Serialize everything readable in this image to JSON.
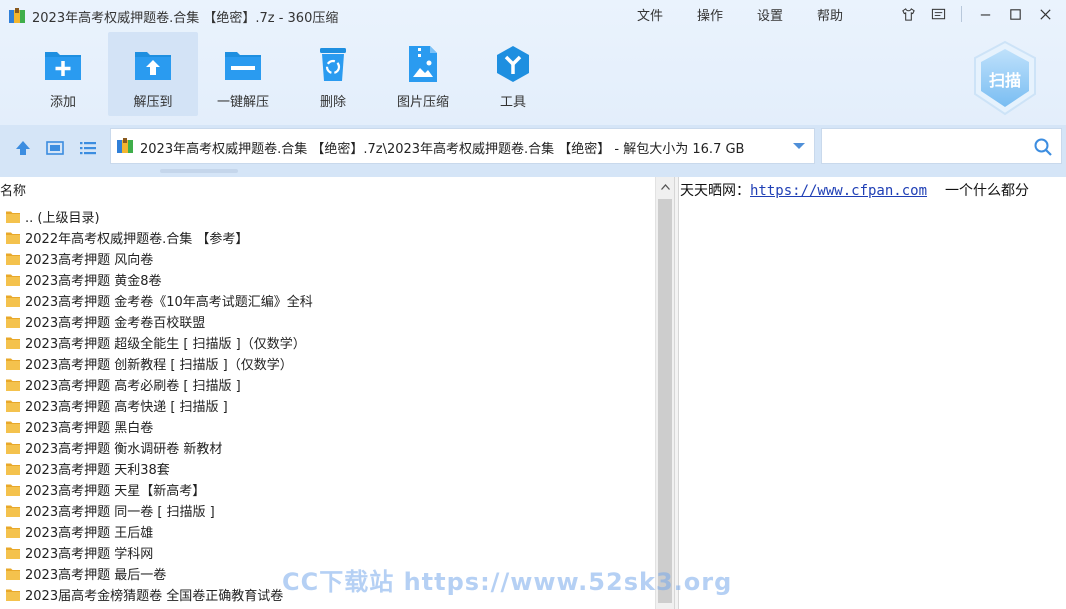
{
  "window": {
    "title": "2023年高考权威押题卷.合集 【绝密】.7z - 360压缩",
    "menu": [
      "文件",
      "操作",
      "设置",
      "帮助"
    ]
  },
  "toolbar": {
    "tools": [
      {
        "label": "添加",
        "icon": "add-icon"
      },
      {
        "label": "解压到",
        "icon": "extract-to-icon"
      },
      {
        "label": "一键解压",
        "icon": "one-click-extract-icon"
      },
      {
        "label": "删除",
        "icon": "delete-icon"
      },
      {
        "label": "图片压缩",
        "icon": "image-compress-icon"
      },
      {
        "label": "工具",
        "icon": "tools-icon"
      }
    ],
    "active_index": 1,
    "scan_label": "扫描"
  },
  "address_bar": {
    "path": "2023年高考权威押题卷.合集 【绝密】.7z\\2023年高考权威押题卷.合集 【绝密】 - 解包大小为 16.7 GB",
    "search_placeholder": ""
  },
  "file_list": {
    "column_name": "名称",
    "items": [
      ".. (上级目录)",
      "2022年高考权威押题卷.合集 【参考】",
      "2023高考押题  风向卷",
      "2023高考押题  黄金8卷",
      "2023高考押题  金考卷《10年高考试题汇编》全科",
      "2023高考押题  金考卷百校联盟",
      "2023高考押题 超级全能生 [ 扫描版 ]（仅数学）",
      "2023高考押题 创新教程 [ 扫描版 ]（仅数学）",
      "2023高考押题 高考必刷卷 [ 扫描版 ]",
      "2023高考押题 高考快递 [ 扫描版 ]",
      "2023高考押题 黑白卷",
      "2023高考押题 衡水调研卷  新教材",
      "2023高考押题 天利38套",
      "2023高考押题 天星【新高考】",
      "2023高考押题 同一卷 [ 扫描版 ]",
      "2023高考押题 王后雄",
      "2023高考押题 学科网",
      "2023高考押题 最后一卷",
      "2023届高考金榜猜题卷 全国卷正确教育试卷"
    ]
  },
  "preview": {
    "prefix": "天天晒网：",
    "link": "https://www.cfpan.com",
    "suffix": "一个什么都分"
  },
  "watermark": "CC下载站 https://www.52sk3.org",
  "colors": {
    "accent": "#1e8fe0",
    "folder": "#f4b63a",
    "toolbar_bg": "#e6f0fc",
    "address_row_bg": "#d5e5f7"
  }
}
